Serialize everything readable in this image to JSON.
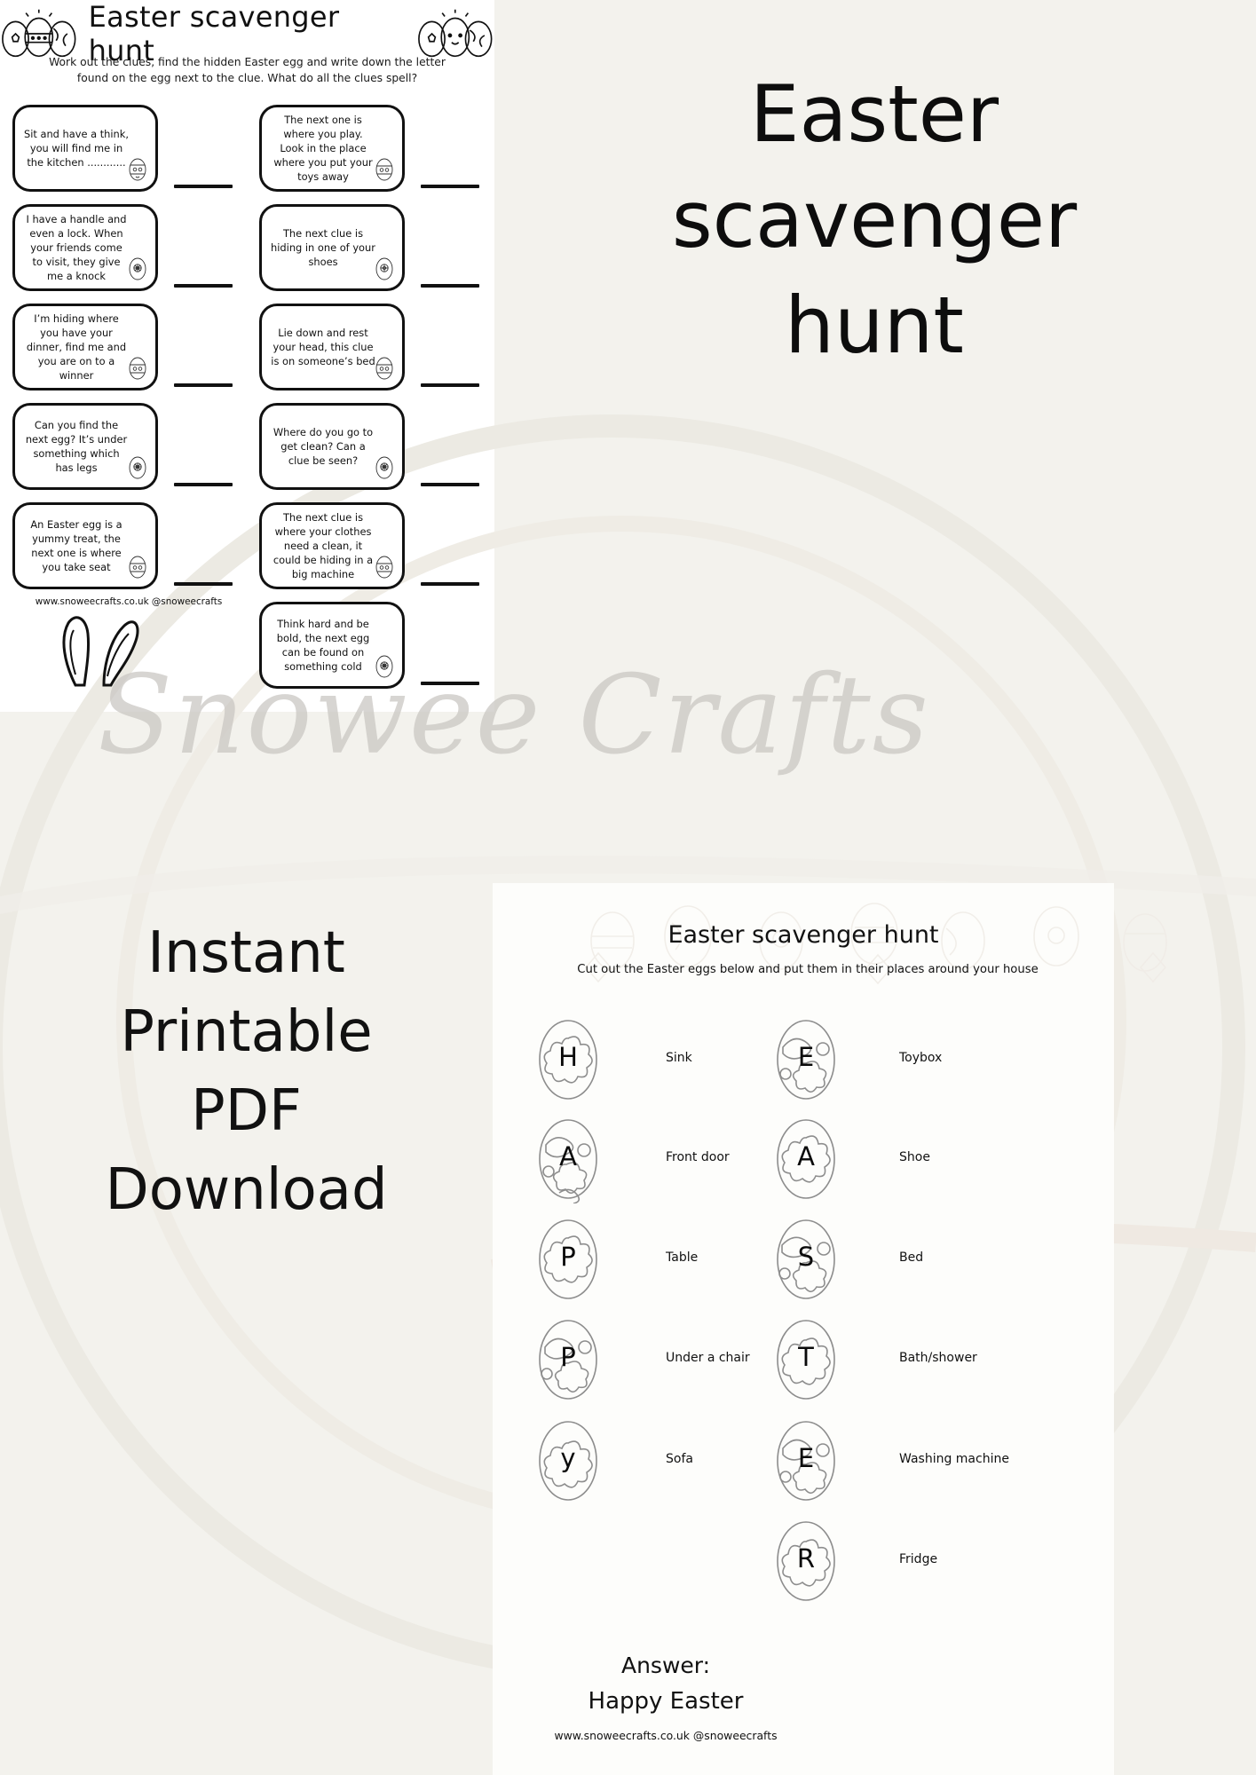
{
  "sheet1": {
    "title": "Easter scavenger hunt",
    "instructions": "Work out the clues, find the hidden Easter egg and write down the letter found on the egg next to the clue. What do all the clues spell?",
    "website": "www.snoweecrafts.co.uk @snoweecrafts",
    "clues_left": [
      "Sit and have a think, you will find me in the kitchen ............",
      "I have a handle and even a lock. When your friends come to visit, they give me a knock",
      "I’m hiding where you have your dinner, find me and you are on to a winner",
      "Can you find the next egg? It’s under something which has legs",
      "An Easter egg is a yummy treat, the next one is where you take seat"
    ],
    "clues_right": [
      "The next one is where you play. Look in the place where you put your toys away",
      "The next clue is hiding in one of your shoes",
      "Lie down and rest your head, this clue is on someone’s bed",
      "Where do you go to get clean? Can a clue be seen?",
      "The next clue is where your clothes need a clean, it could be hiding in a big machine",
      "Think hard and be bold, the next egg can be found on something cold"
    ]
  },
  "hero": {
    "title_lines": [
      "Easter",
      "scavenger",
      "hunt"
    ]
  },
  "promo": {
    "lines": [
      "Instant",
      "Printable",
      "PDF",
      "Download"
    ]
  },
  "sheet2": {
    "title": "Easter scavenger hunt",
    "instructions": "Cut out the Easter eggs below and put them in their places around your house",
    "answer_label": "Answer:",
    "answer_value": "Happy Easter",
    "website": "www.snoweecrafts.co.uk @snoweecrafts",
    "eggs_left": [
      {
        "letter": "H",
        "label": "Sink",
        "pattern": "flower"
      },
      {
        "letter": "A",
        "label": "Front door",
        "pattern": "blobs"
      },
      {
        "letter": "P",
        "label": "Table",
        "pattern": "flower"
      },
      {
        "letter": "P",
        "label": "Under a chair",
        "pattern": "blobs"
      },
      {
        "letter": "y",
        "label": "Sofa",
        "pattern": "flower"
      }
    ],
    "eggs_right": [
      {
        "letter": "E",
        "label": "Toybox",
        "pattern": "blobs"
      },
      {
        "letter": "A",
        "label": "Shoe",
        "pattern": "flower"
      },
      {
        "letter": "S",
        "label": "Bed",
        "pattern": "blobs"
      },
      {
        "letter": "T",
        "label": "Bath/shower",
        "pattern": "flower"
      },
      {
        "letter": "E",
        "label": "Washing machine",
        "pattern": "blobs"
      },
      {
        "letter": "R",
        "label": "Fridge",
        "pattern": "flower"
      }
    ]
  },
  "watermark": {
    "text": "Snowee Crafts"
  },
  "colors": {
    "paper": "#ffffff",
    "background": "#f3f2ed",
    "ink": "#111111",
    "light_outline": "#8d8d8d",
    "watermark": "#c9c6c2"
  }
}
